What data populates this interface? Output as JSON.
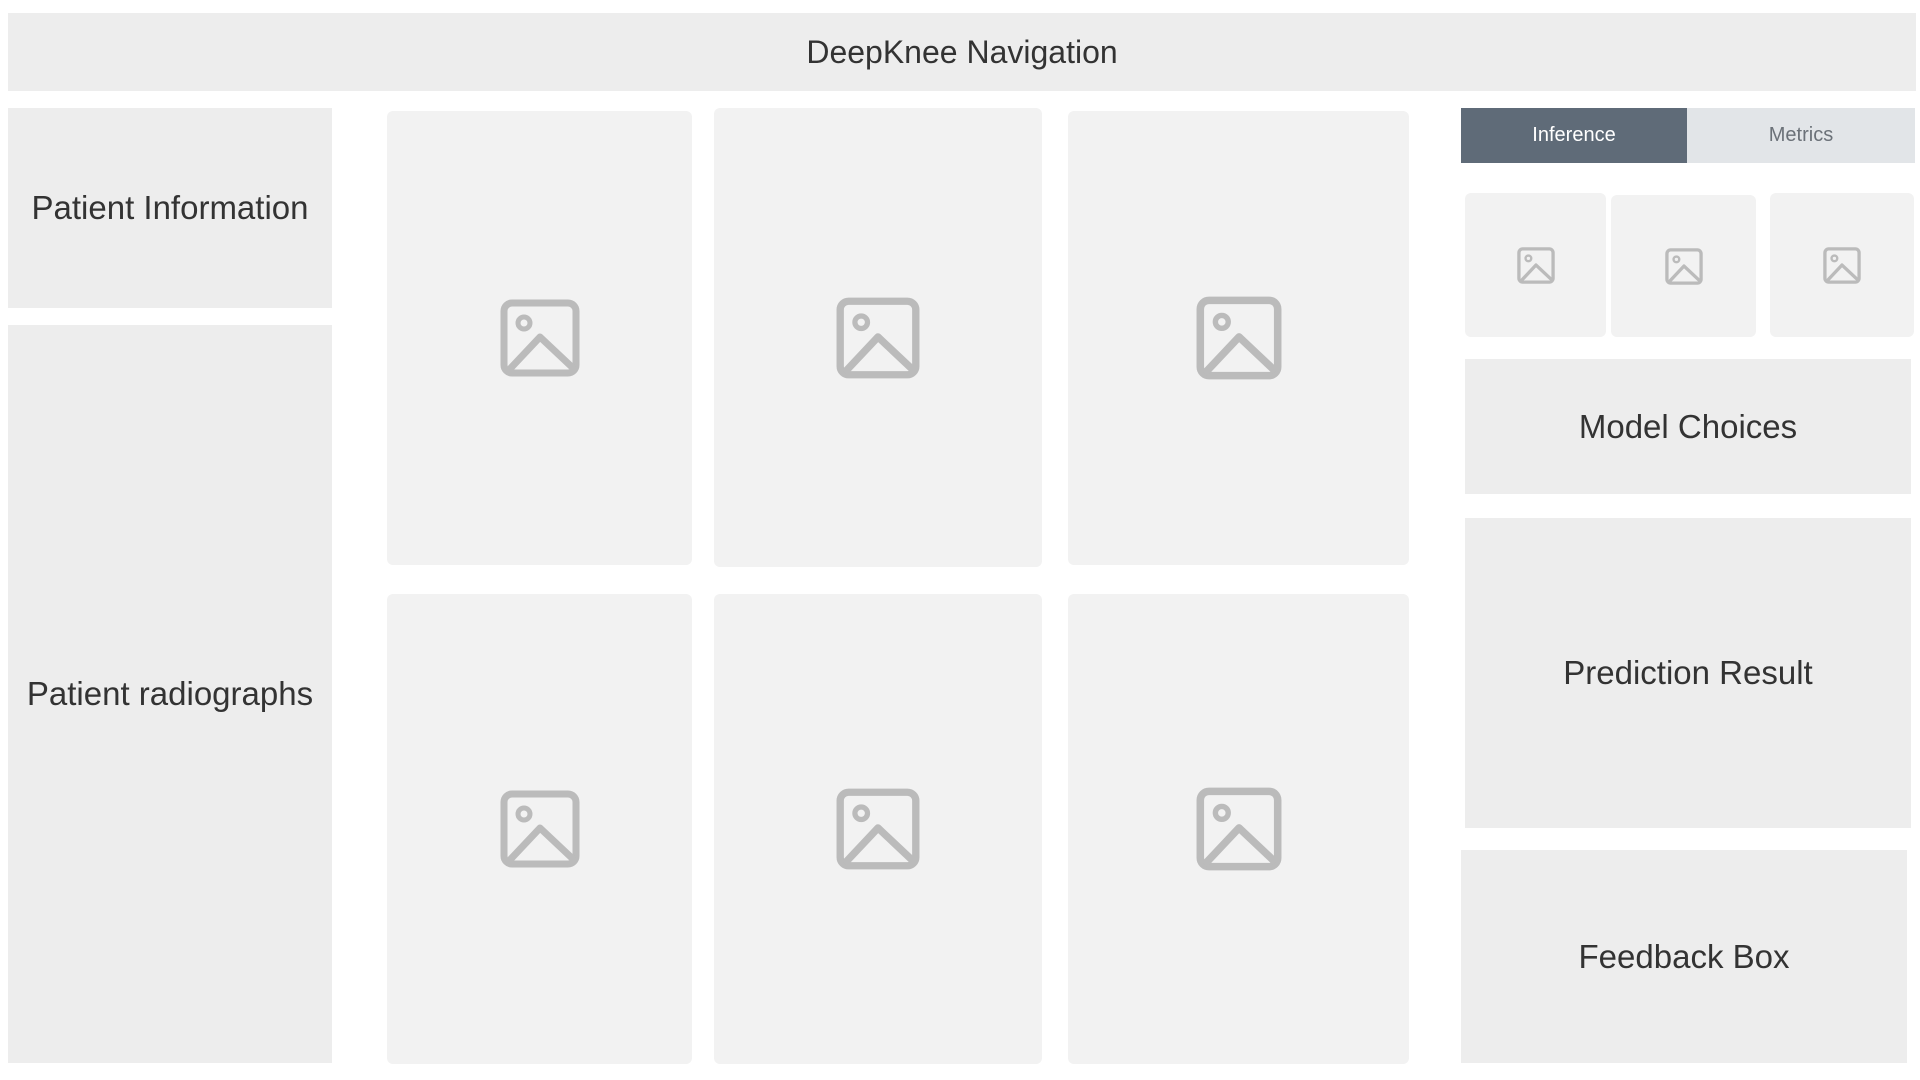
{
  "header": {
    "title": "DeepKnee Navigation"
  },
  "left_panel": {
    "patient_info_label": "Patient Information",
    "radiographs_label": "Patient radiographs"
  },
  "image_grid": {
    "icon": "image-placeholder-icon",
    "count": 6
  },
  "right_panel": {
    "tabs": [
      {
        "label": "Inference",
        "active": true
      },
      {
        "label": "Metrics",
        "active": false
      }
    ],
    "thumbnail_icon": "image-placeholder-icon",
    "model_choices_label": "Model Choices",
    "prediction_result_label": "Prediction Result",
    "feedback_box_label": "Feedback Box"
  },
  "colors": {
    "panel_bg": "#ededed",
    "card_bg": "#f2f2f2",
    "tab_active_bg": "#5f6b78",
    "tab_inactive_bg": "#e2e5e8",
    "icon_color": "#bbbbbb"
  }
}
